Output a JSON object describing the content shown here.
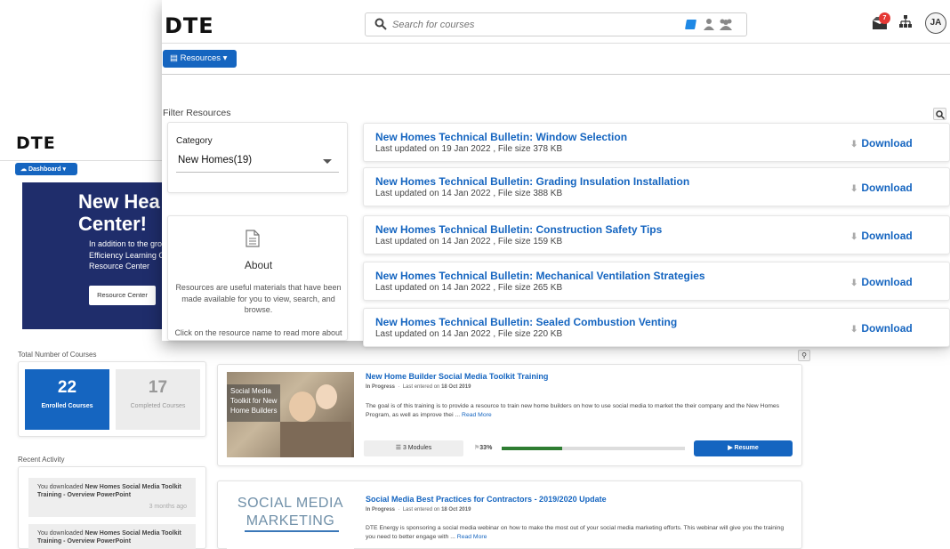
{
  "back": {
    "logo": "DTE",
    "dashboard_label": "Dashboard ▾",
    "hero": {
      "title_line1": "New Hea",
      "title_line2": "Center!",
      "text_line1": "In addition to the grov",
      "text_line2": "Efficiency Learning Ce",
      "text_line3": "Resource Center",
      "button_label": "Resource Center"
    },
    "total_courses_heading": "Total Number of Courses",
    "stats": [
      {
        "value": "22",
        "label": "Enrolled Courses"
      },
      {
        "value": "17",
        "label": "Completed Courses"
      }
    ],
    "recent_activity_heading": "Recent Activity",
    "activity": [
      {
        "prefix": "You downloaded ",
        "bold": "New Homes Social Media Toolkit Training - Overview PowerPoint",
        "time": "3 months ago"
      },
      {
        "prefix": "You downloaded ",
        "bold": "New Homes Social Media Toolkit Training - Overview PowerPoint",
        "time": ""
      }
    ],
    "courses": [
      {
        "thumb_lines": [
          "Social Media",
          "Toolkit for New",
          "Home Builders"
        ],
        "title": "New Home Builder Social Media Toolkit Training",
        "status": "In Progress",
        "entered_prefix": "Last entered on ",
        "entered_date": "18 Oct 2019",
        "description": "The goal is of this training is to provide a resource to train new home builders on how to use social media to market the their company and the New Homes Program, as well as improve thei ...",
        "read_more": "Read More",
        "modules": "3 Modules",
        "progress_label": "33%",
        "progress": 0.33,
        "resume_label": "Resume"
      },
      {
        "thumb_lines": [
          "SOCIAL MEDIA",
          "MARKETING"
        ],
        "title": "Social Media Best Practices for Contractors - 2019/2020 Update",
        "status": "In Progress",
        "entered_prefix": "Last entered on ",
        "entered_date": "18 Oct 2019",
        "description": "DTE Energy is sponsoring a social media webinar on how to make the most out of your social media marketing efforts. This webinar will give you the training you need to better engage with ...",
        "read_more": "Read More"
      }
    ]
  },
  "front": {
    "logo": "DTE",
    "search_placeholder": "Search for courses",
    "notification_count": "7",
    "avatar_initials": "JA",
    "resources_label": "Resources ▾",
    "filter_heading": "Filter Resources",
    "category_label": "Category",
    "category_value": "New Homes(19)",
    "about_heading": "About",
    "about_text": "Resources are useful materials that have been made available for you to view, search, and browse.",
    "about_text2": "Click on the resource name to read more about",
    "download_label": "Download",
    "resources": [
      {
        "title": "New Homes Technical Bulletin: Window Selection",
        "meta": "Last updated on 19 Jan 2022 , File size 378 KB"
      },
      {
        "title": "New Homes Technical Bulletin: Grading Insulation Installation",
        "meta": "Last updated on 14 Jan 2022 , File size 388 KB"
      },
      {
        "title": "New Homes Technical Bulletin: Construction Safety Tips",
        "meta": "Last updated on 14 Jan 2022 , File size 159 KB"
      },
      {
        "title": "New Homes Technical Bulletin: Mechanical Ventilation Strategies",
        "meta": "Last updated on 14 Jan 2022 , File size 265 KB"
      },
      {
        "title": "New Homes Technical Bulletin: Sealed Combustion Venting",
        "meta": "Last updated on 14 Jan 2022 , File size 220 KB"
      }
    ]
  }
}
